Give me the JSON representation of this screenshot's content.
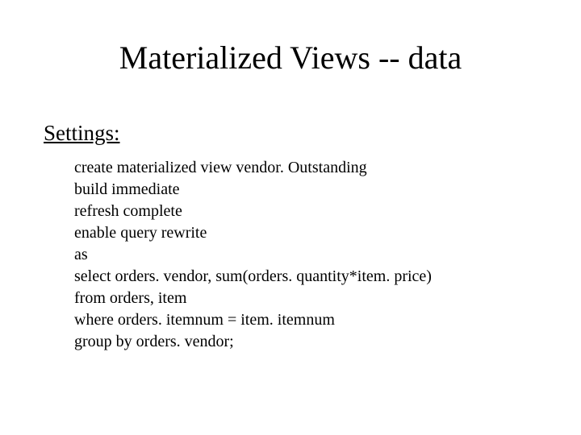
{
  "title": "Materialized Views -- data",
  "settings_label": "Settings:",
  "code_lines": [
    "create materialized view vendor. Outstanding",
    "build immediate",
    "refresh complete",
    "enable query rewrite",
    "as",
    "select orders. vendor, sum(orders. quantity*item. price)",
    "from orders, item",
    "where orders. itemnum = item. itemnum",
    "group by orders. vendor;"
  ]
}
